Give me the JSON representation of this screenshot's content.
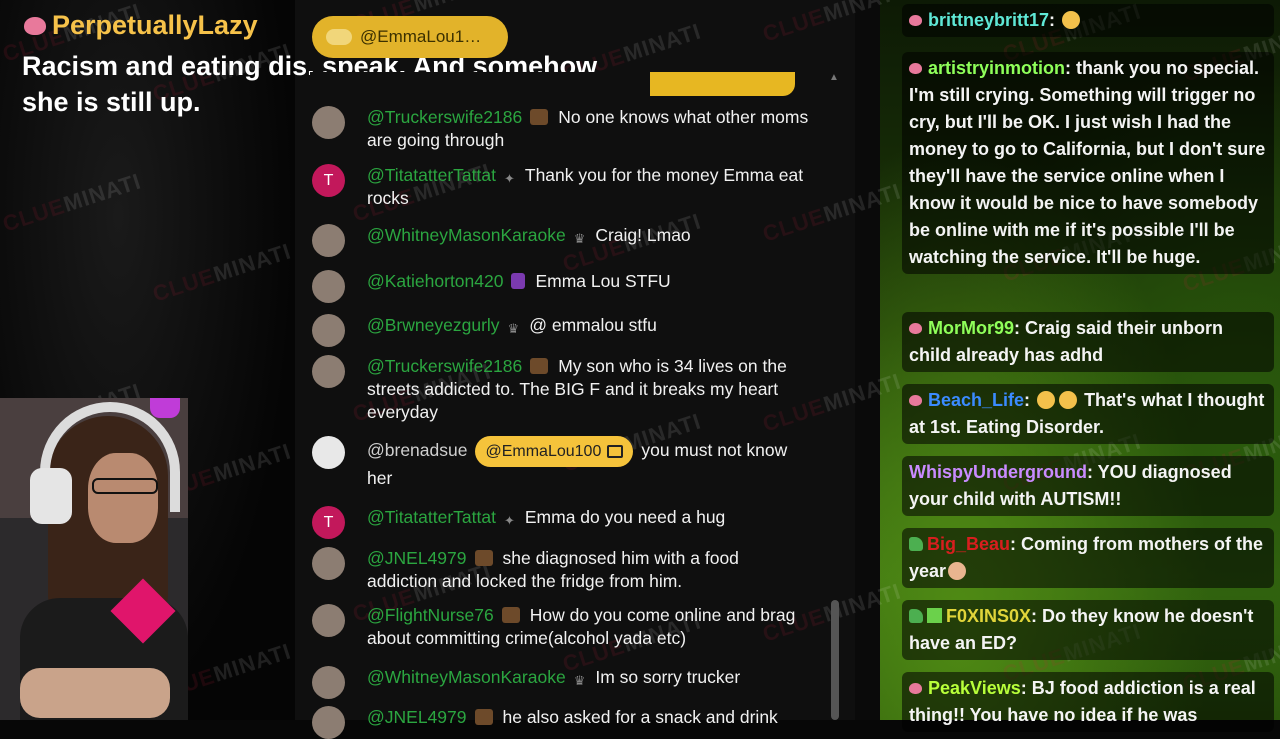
{
  "alert": {
    "username": "PerpetuallyLazy",
    "message": "Racism and eating dis. speak. And somehow she is still up."
  },
  "watermark": {
    "text_a": "CLUE",
    "text_b": "MINATI"
  },
  "mid_chat": {
    "pinned_user": "@EmmaLou1…",
    "messages": [
      {
        "name": "@Truckerswife2186",
        "text": "No one knows what other moms are going through",
        "avatar": "photo"
      },
      {
        "name": "@TitatatterTattat",
        "text": "Thank you for the money Emma eat rocks",
        "avatar": "T"
      },
      {
        "name": "@WhitneyMasonKaraoke",
        "text": "Craig! Lmao",
        "avatar": "photo"
      },
      {
        "name": "@Katiehorton420",
        "text": "Emma Lou STFU",
        "avatar": "photo"
      },
      {
        "name": "@Brwneyezgurly",
        "text": "@ emmalou stfu",
        "avatar": "photo"
      },
      {
        "name": "@Truckerswife2186",
        "text": "My son who is 34 lives on the streets addicted to. The BIG F and it breaks my heart everyday",
        "avatar": "photo"
      },
      {
        "name": "@brenadsue",
        "mention": "@EmmaLou100",
        "text": "you must not know her",
        "avatar": "headset"
      },
      {
        "name": "@TitatatterTattat",
        "text": "Emma do you need a hug",
        "avatar": "T"
      },
      {
        "name": "@JNEL4979",
        "text": "she diagnosed him with a food addiction and locked the fridge from him.",
        "avatar": "photo"
      },
      {
        "name": "@FlightNurse76",
        "text": "How do you come online and brag about committing crime(alcohol yada etc)",
        "avatar": "photo"
      },
      {
        "name": "@WhitneyMasonKaraoke",
        "text": "Im so sorry trucker",
        "avatar": "photo"
      },
      {
        "name": "@JNEL4979",
        "text": "he also asked for a snack and drink",
        "avatar": "photo"
      }
    ]
  },
  "right_chat": {
    "messages": [
      {
        "name": "brittneybritt17",
        "color": "#5fe8d6",
        "text": ""
      },
      {
        "name": "artistryinmotion",
        "color": "#8fff5a",
        "text": "thank you no special. I'm still crying. Something will trigger no cry, but I'll be OK. I just wish I had the money to go to California, but I don't sure they'll have the service online when I know it would be nice to have somebody be online with me if it's possible I'll be watching the service. It'll be huge."
      },
      {
        "name": "MorMor99",
        "color": "#8fff5a",
        "text": "Craig said their unborn child already has adhd"
      },
      {
        "name": "Beach_Life",
        "color": "#3b8bff",
        "text": "That's what I thought at 1st. Eating Disorder."
      },
      {
        "name": "WhispyUnderground",
        "color": "#c98bff",
        "text": "YOU diagnosed your child with AUTISM!!"
      },
      {
        "name": "Big_Beau",
        "color": "#d81e1e",
        "text": "Coming from mothers of the year"
      },
      {
        "name": "F0XINS0X",
        "color": "#e0d43a",
        "text": "Do they know he doesn't have an ED?"
      },
      {
        "name": "PeakViews",
        "color": "#b8ff3a",
        "text": "BJ food addiction is a real thing!! You have no idea if he was"
      }
    ]
  }
}
